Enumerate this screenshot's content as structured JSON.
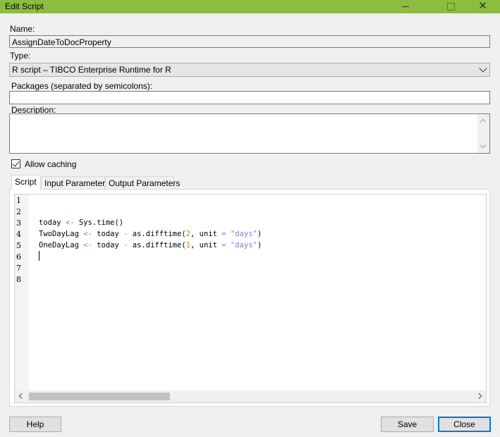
{
  "window": {
    "title": "Edit Script",
    "minimize_icon": "minimize-icon",
    "maximize_icon": "maximize-icon",
    "close_icon": "close-icon"
  },
  "form": {
    "name_label": "Name:",
    "name_value": "AssignDateToDocProperty",
    "type_label": "Type:",
    "type_value": "R script – TIBCO Enterprise Runtime for R",
    "packages_label": "Packages (separated by semicolons):",
    "packages_value": "",
    "description_label": "Description:",
    "description_value": "",
    "allow_caching_label": "Allow caching",
    "allow_caching_checked": true
  },
  "tabs": [
    {
      "label": "Script",
      "active": true
    },
    {
      "label": "Input Parameters",
      "active": false
    },
    {
      "label": "Output Parameters",
      "active": false
    }
  ],
  "editor": {
    "line_numbers": [
      "1",
      "2",
      "3",
      "4",
      "5",
      "6",
      "7",
      "8"
    ],
    "lines": [
      "",
      "",
      "today <- Sys.time()",
      "TwoDayLag <- today - as.difftime(2, unit = \"days\")",
      "OneDayLag <- today - as.difftime(1, unit = \"days\")",
      "",
      "",
      ""
    ]
  },
  "buttons": {
    "help": "Help",
    "save": "Save",
    "close": "Close"
  },
  "colors": {
    "titlebar": "#8cbd3f",
    "default_button_border": "#0078d7"
  }
}
